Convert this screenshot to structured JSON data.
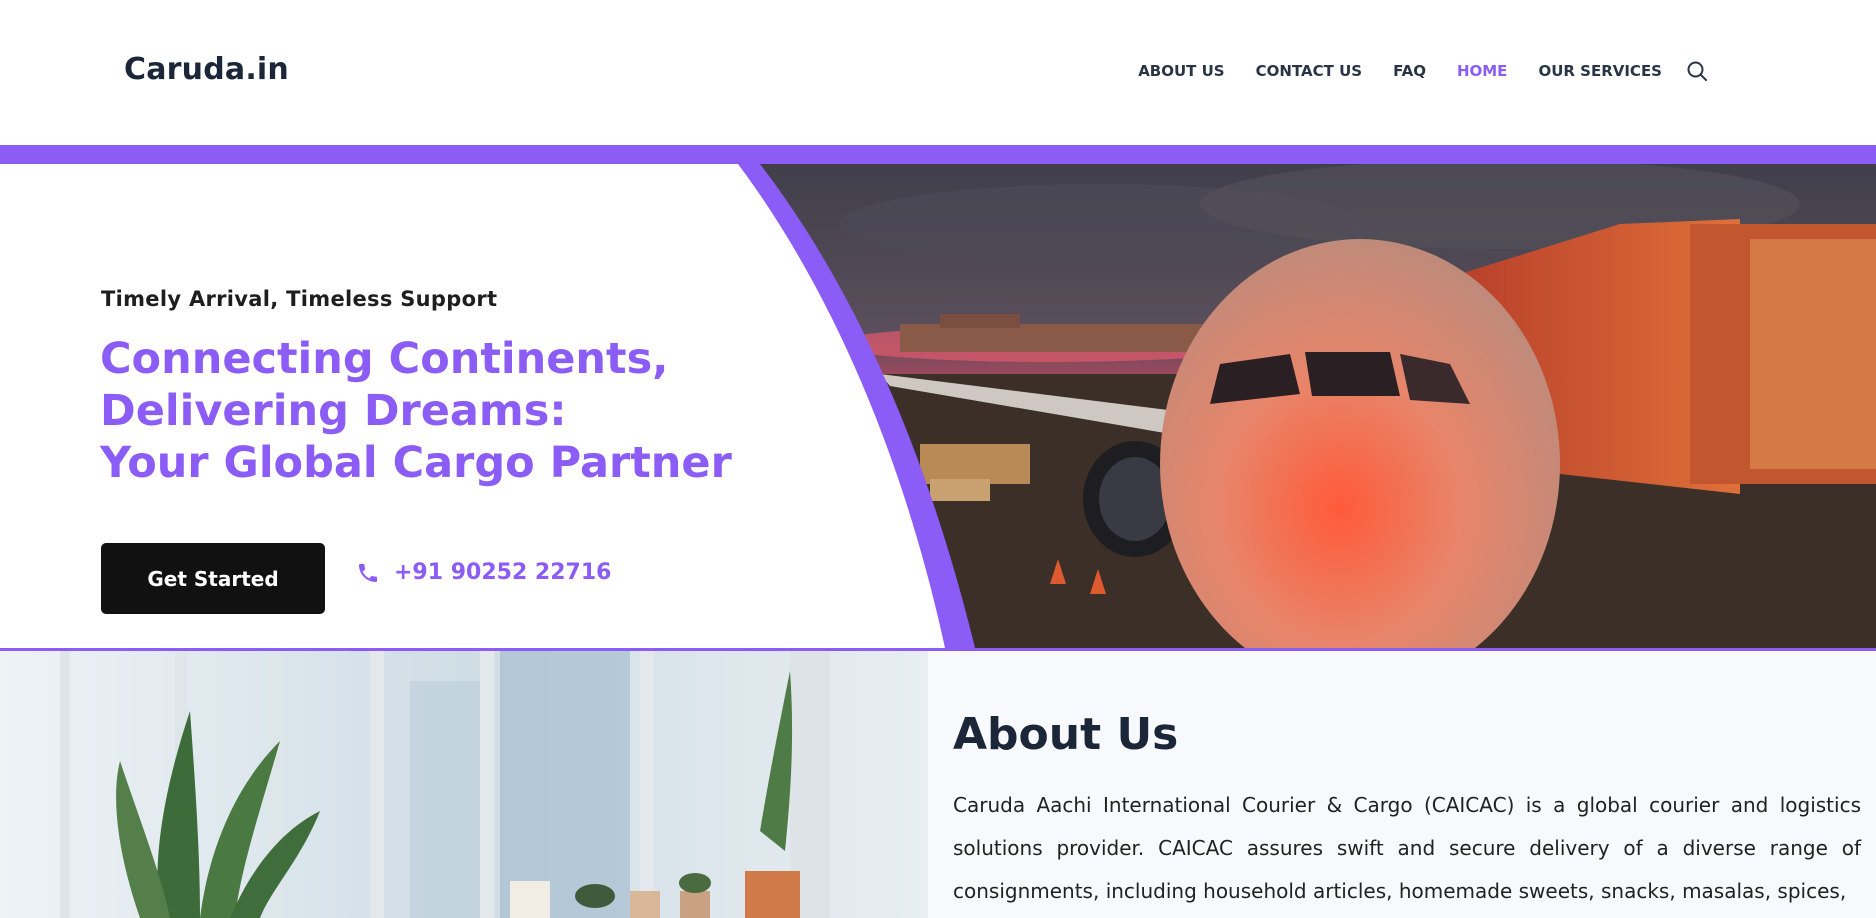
{
  "header": {
    "logo": "Caruda.in",
    "nav": [
      {
        "label": "ABOUT US",
        "active": false
      },
      {
        "label": "CONTACT US",
        "active": false
      },
      {
        "label": "FAQ",
        "active": false
      },
      {
        "label": "HOME",
        "active": true
      },
      {
        "label": "OUR SERVICES",
        "active": false
      }
    ],
    "search_icon": "search-icon"
  },
  "hero": {
    "tagline": "Timely Arrival, Timeless Support",
    "headline_lines": [
      "Connecting Continents,",
      "Delivering Dreams:",
      "Your Global Cargo Partner"
    ],
    "cta_label": "Get Started",
    "phone": "+91 90252 22716",
    "phone_icon": "phone-icon",
    "image": "airplane-at-gate-photo"
  },
  "about": {
    "title": "About Us",
    "text": "Caruda Aachi International Courier & Cargo (CAICAC) is a global courier and logistics solutions provider. CAICAC assures swift and secure delivery of a diverse range of consignments, including household articles, homemade sweets, snacks, masalas, spices,",
    "image": "office-plants-photo"
  },
  "colors": {
    "accent": "#8b5cf6",
    "dark": "#1b2638",
    "button": "#111111"
  }
}
